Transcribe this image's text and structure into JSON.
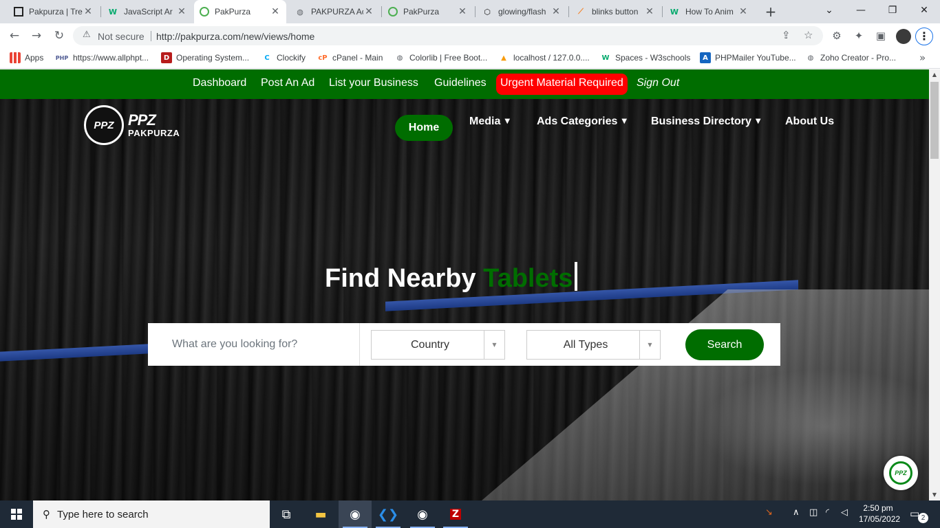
{
  "browser": {
    "tabs": [
      {
        "title": "Pakpurza | Tre",
        "icon": "pakpurza-icon"
      },
      {
        "title": "JavaScript Ar",
        "icon": "w3schools-icon"
      },
      {
        "title": "PakPurza",
        "icon": "pakpurza-chrome-icon",
        "active": true
      },
      {
        "title": "PAKPURZA Ac",
        "icon": "globe-icon"
      },
      {
        "title": "PakPurza",
        "icon": "pakpurza-chrome-icon"
      },
      {
        "title": "glowing/flash",
        "icon": "codepen-icon"
      },
      {
        "title": "blinks button",
        "icon": "stackoverflow-icon"
      },
      {
        "title": "How To Anim",
        "icon": "w3schools-icon"
      }
    ],
    "address": {
      "security": "Not secure",
      "url": "http://pakpurza.com/new/views/home"
    },
    "bookmarks": [
      {
        "label": "Apps"
      },
      {
        "label": "https://www.allphpt..."
      },
      {
        "label": "Operating System..."
      },
      {
        "label": "Clockify"
      },
      {
        "label": "cPanel - Main"
      },
      {
        "label": "Colorlib | Free Boot..."
      },
      {
        "label": "localhost / 127.0.0...."
      },
      {
        "label": "Spaces - W3schools"
      },
      {
        "label": "PHPMailer YouTube..."
      },
      {
        "label": "Zoho Creator - Pro..."
      }
    ]
  },
  "site": {
    "topnav": {
      "dashboard": "Dashboard",
      "post_ad": "Post An Ad",
      "list_business": "List your Business",
      "guidelines": "Guidelines",
      "urgent": "Urgent Material Required",
      "signout": "Sign Out"
    },
    "logo": {
      "mark": "PPZ",
      "word": "PAKPURZA"
    },
    "mainnav": {
      "home": "Home",
      "media": "Media",
      "ads_categories": "Ads Categories",
      "business_directory": "Business Directory",
      "about": "About Us"
    },
    "headline": {
      "prefix": "Find Nearby",
      "accent": "Tablets"
    },
    "search": {
      "placeholder": "What are you looking for?",
      "country": "Country",
      "type": "All Types",
      "button": "Search"
    },
    "colors": {
      "brand_green": "#006d00",
      "urgent_red": "#ff0000"
    }
  },
  "taskbar": {
    "search_placeholder": "Type here to search",
    "time": "2:50 pm",
    "date": "17/05/2022",
    "notifications": "2"
  }
}
